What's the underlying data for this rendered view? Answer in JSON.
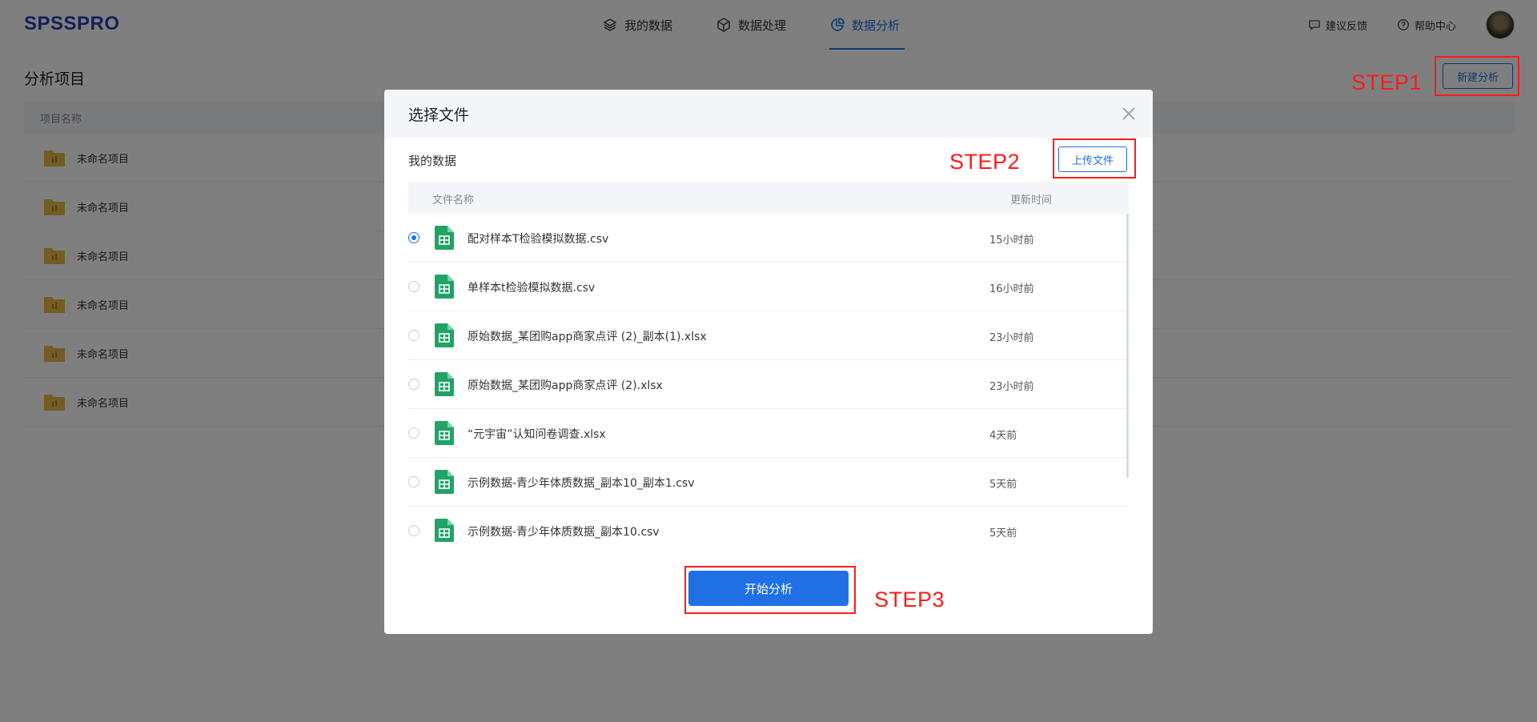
{
  "header": {
    "logo": "SPSSPRO",
    "nav": [
      {
        "label": "我的数据",
        "icon": "layers-icon",
        "active": false
      },
      {
        "label": "数据处理",
        "icon": "cube-icon",
        "active": false
      },
      {
        "label": "数据分析",
        "icon": "pie-chart-icon",
        "active": true
      }
    ],
    "feedback_label": "建议反馈",
    "help_label": "帮助中心"
  },
  "page": {
    "title": "分析项目",
    "new_button": "新建分析",
    "column_name": "项目名称",
    "projects": [
      "未命名项目",
      "未命名项目",
      "未命名项目",
      "未命名项目",
      "未命名项目",
      "未命名项目"
    ]
  },
  "modal": {
    "title": "选择文件",
    "section_title": "我的数据",
    "upload_button": "上传文件",
    "columns": {
      "name": "文件名称",
      "time": "更新时间"
    },
    "files": [
      {
        "name": "配对样本T检验模拟数据.csv",
        "time": "15小时前",
        "selected": true
      },
      {
        "name": "单样本t检验模拟数据.csv",
        "time": "16小时前",
        "selected": false
      },
      {
        "name": "原始数据_某团购app商家点评 (2)_副本(1).xlsx",
        "time": "23小时前",
        "selected": false
      },
      {
        "name": "原始数据_某团购app商家点评 (2).xlsx",
        "time": "23小时前",
        "selected": false
      },
      {
        "name": "“元宇宙”认知问卷调查.xlsx",
        "time": "4天前",
        "selected": false
      },
      {
        "name": "示例数据-青少年体质数据_副本10_副本1.csv",
        "time": "5天前",
        "selected": false
      },
      {
        "name": "示例数据-青少年体质数据_副本10.csv",
        "time": "5天前",
        "selected": false
      }
    ],
    "start_button": "开始分析"
  },
  "annotations": {
    "step1": "STEP1",
    "step2": "STEP2",
    "step3": "STEP3"
  },
  "colors": {
    "brand": "#2b3fb6",
    "accent": "#1f6fe5",
    "annotation": "#ff1a1a",
    "file_icon": "#21a366",
    "folder_icon": "#e8b84a"
  }
}
